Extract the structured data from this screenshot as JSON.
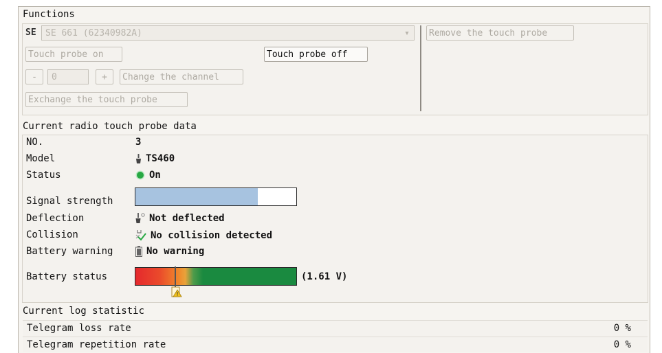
{
  "functions": {
    "title": "Functions",
    "se_label": "SE",
    "se_value": "SE 661 (62340982A)",
    "touch_probe_on": "Touch probe on",
    "touch_probe_off": "Touch probe off",
    "minus": "-",
    "channel_value": "0",
    "plus": "+",
    "change_channel": "Change the channel",
    "exchange_probe": "Exchange the touch probe",
    "remove_probe": "Remove the touch probe"
  },
  "probe_data": {
    "title": "Current radio touch probe data",
    "rows": [
      {
        "label": "NO.",
        "value": "3"
      },
      {
        "label": "Model",
        "value": "TS460",
        "icon": "probe-icon"
      },
      {
        "label": "Status",
        "value": "On",
        "icon": "status-dot-icon"
      },
      {
        "label": "Signal strength",
        "value": "",
        "level": 0.76
      },
      {
        "label": "Deflection",
        "value": "Not deflected",
        "icon": "deflection-icon"
      },
      {
        "label": "Collision",
        "value": "No collision detected",
        "icon": "collision-icon"
      },
      {
        "label": "Battery warning",
        "value": "No warning",
        "icon": "battery-icon"
      },
      {
        "label": "Battery status",
        "value": "(1.61 V)",
        "icon": "warning-marker-icon"
      }
    ],
    "colors": {
      "signal_fill": "#a7c3e0",
      "status_on": "#27a843",
      "battery_red": "#e5292d",
      "battery_orange": "#f08a2b",
      "battery_green": "#1a8a40"
    }
  },
  "log": {
    "title": "Current log statistic",
    "rows": [
      {
        "label": "Telegram loss rate",
        "value": "0 %"
      },
      {
        "label": "Telegram repetition rate",
        "value": "0 %"
      }
    ]
  }
}
